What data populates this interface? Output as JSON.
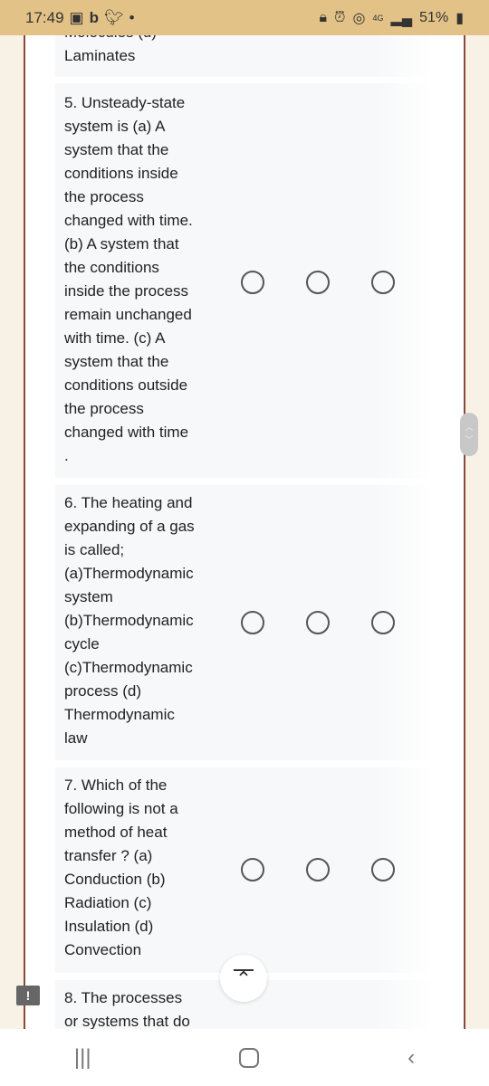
{
  "status_bar": {
    "time": "17:49",
    "battery": "51%",
    "network": "4G"
  },
  "partial_prev": {
    "lines": [
      "Molecules (d)",
      "Laminates"
    ]
  },
  "questions": [
    {
      "lines": [
        "5. Unsteady-state",
        "system is (a) A",
        "system that the",
        "conditions inside",
        "the process",
        "changed with time.",
        "(b) A system that",
        "the conditions",
        "inside the process",
        "remain unchanged",
        "with time. (c) A",
        "system that the",
        "conditions outside",
        "the process",
        "changed with time",
        "."
      ]
    },
    {
      "lines": [
        "6. The heating and",
        "expanding of a gas",
        "is called;",
        "(a)Thermodynamic",
        "system",
        "(b)Thermodynamic",
        "cycle",
        "(c)Thermodynamic",
        "process (d)",
        "Thermodynamic",
        "law"
      ]
    },
    {
      "lines": [
        "7. Which of the",
        "following is not a",
        "method of heat",
        "transfer ? (a)",
        "Conduction (b)",
        "Radiation (c)",
        "Insulation (d)",
        "Convection"
      ]
    },
    {
      "lines": [
        "8. The processes",
        "or systems that do"
      ]
    }
  ],
  "icons": {
    "scroll_top": "chevron-up-bar-icon",
    "feedback": "feedback-icon",
    "nav": [
      "recents-icon",
      "home-icon",
      "back-icon"
    ]
  }
}
